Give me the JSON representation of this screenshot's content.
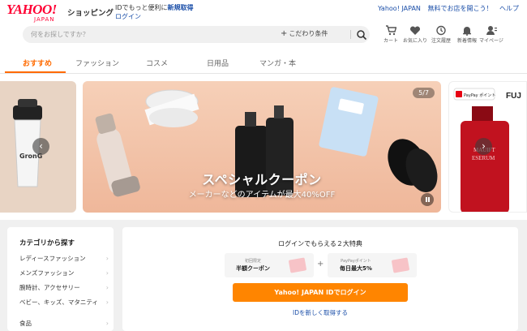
{
  "header": {
    "logo_main": "YAHOO!",
    "logo_sub": "JAPAN",
    "shop_label": "ショッピング",
    "id_message": "IDでもっと便利に",
    "id_new": "新規取得",
    "id_login": "ログイン",
    "links": [
      "Yahoo! JAPAN",
      "無料でお店を開こう！",
      "ヘルプ"
    ]
  },
  "search": {
    "placeholder": "何をお探しですか？",
    "refine_label": "こだわり条件"
  },
  "header_icons": [
    {
      "label": "カート",
      "icon": "cart-icon"
    },
    {
      "label": "お気に入り",
      "icon": "heart-icon"
    },
    {
      "label": "注文履歴",
      "icon": "history-icon"
    },
    {
      "label": "新着情報",
      "icon": "bell-icon"
    },
    {
      "label": "マイページ",
      "icon": "user-icon"
    }
  ],
  "tabs": [
    {
      "label": "おすすめ",
      "active": true
    },
    {
      "label": "ファッション",
      "active": false
    },
    {
      "label": "コスメ",
      "active": false
    },
    {
      "label": "日用品",
      "active": false
    },
    {
      "label": "マンガ・本",
      "active": false
    }
  ],
  "carousel": {
    "counter": "5/7",
    "title": "スペシャルクーポン",
    "subtitle": "メーカーなどのアイテムが最大40%OFF",
    "left_brand": "GronG",
    "right_badge": "PayPay ポイント",
    "right_brand": "FUJ",
    "right_text_1": "MAUIFT",
    "right_text_2": "ESERUM"
  },
  "categories": {
    "title": "カテゴリから探す",
    "items": [
      "レディースファッション",
      "メンズファッション",
      "腕時計、アクセサリー",
      "ベビー、キッズ、マタニティ",
      "食品"
    ]
  },
  "login_panel": {
    "title": "ログインでもらえる２大特典",
    "benefit_1_small": "初回限定",
    "benefit_1_big": "半額クーポン",
    "benefit_2_small": "PayPayポイント",
    "benefit_2_big": "毎日最大5%",
    "plus": "+",
    "login_button": "Yahoo! JAPAN IDでログイン",
    "new_id_link": "IDを新しく取得する"
  },
  "colors": {
    "accent": "#ff6a00",
    "brand_red": "#ff0033",
    "login_button": "#ff8500",
    "link": "#1a4ea8"
  }
}
